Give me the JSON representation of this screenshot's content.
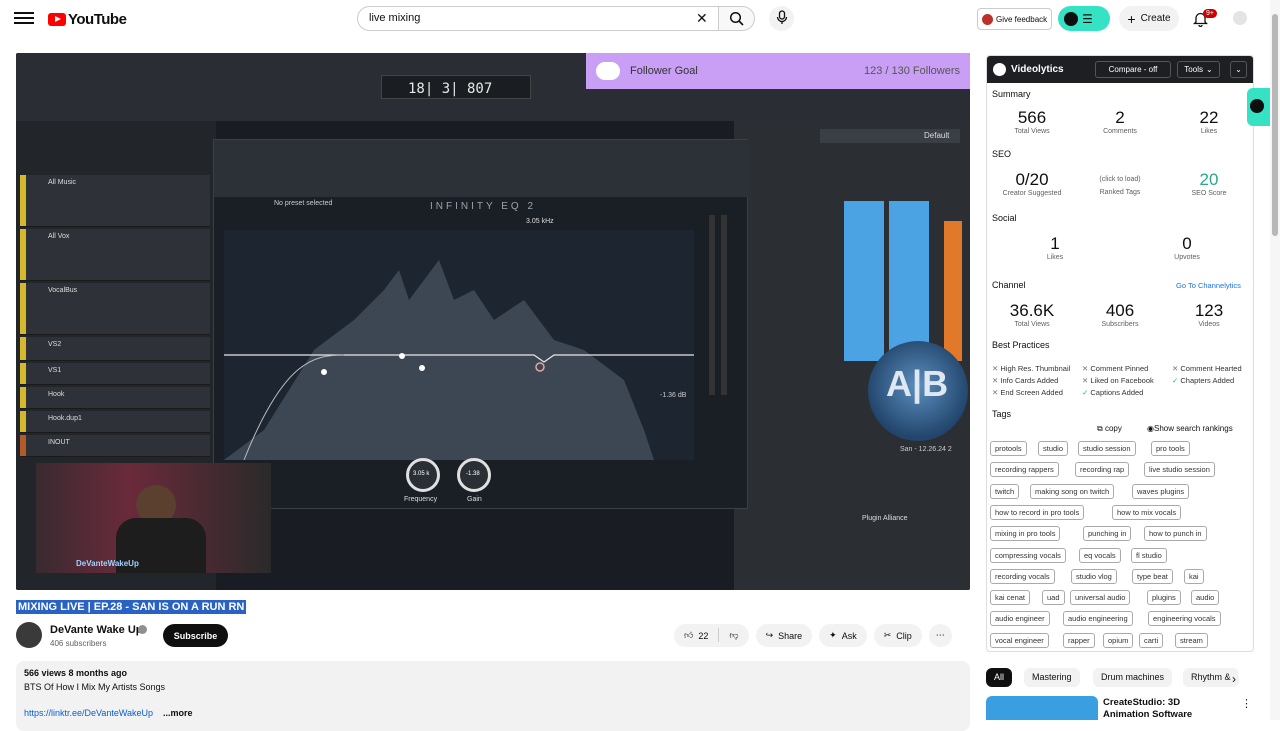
{
  "header": {
    "logo_text": "YouTube",
    "search_value": "live mixing",
    "feedback_label": "Give feedback",
    "create_label": "Create",
    "notif_count": "9+"
  },
  "video": {
    "follower_goal_label": "Follower Goal",
    "follower_goal_count": "123 / 130 Followers",
    "plugin_title": "INFINITY EQ 2",
    "preset_label": "No preset selected",
    "eq_freq_readout": "3.05 kHz",
    "eq_gain_readout": "-1.36 dB",
    "knob_frequency_label": "Frequency",
    "knob_frequency_value": "3.05 k",
    "knob_gain_label": "Gain",
    "knob_gain_value": "-1.38",
    "transport_readout": "18| 3| 807",
    "ab_text": "A|B",
    "ab_caption": "San - 12.26.24 2",
    "plugin_alliance": "Plugin Alliance",
    "default_label": "Default",
    "tracks": [
      "All Music",
      "All Vox",
      "VocalBus",
      "VS2",
      "VS1",
      "Hook",
      "Hook.dup1",
      "INOUT"
    ],
    "webcam_tag": "DeVanteWakeUp"
  },
  "below": {
    "title": "MIXING LIVE | EP.28 - SAN IS ON A RUN RN",
    "channel_name": "DeVante Wake Up",
    "subscribers": "406 subscribers",
    "subscribe_label": "Subscribe",
    "like_count": "22",
    "share_label": "Share",
    "ask_label": "Ask",
    "clip_label": "Clip",
    "views_meta": "566 views  8 months ago",
    "desc_line": "BTS Of How I Mix My Artists Songs",
    "desc_link": "https://linktr.ee/DeVanteWakeUp",
    "more_label": "...more"
  },
  "panel": {
    "title": "Videolytics",
    "compare_label": "Compare - off",
    "tools_label": "Tools",
    "summary_label": "Summary",
    "summary": [
      {
        "num": "566",
        "lbl": "Total Views"
      },
      {
        "num": "2",
        "lbl": "Comments"
      },
      {
        "num": "22",
        "lbl": "Likes"
      }
    ],
    "seo_label": "SEO",
    "seo_suggested_num": "0/20",
    "seo_suggested_lbl": "Creator Suggested",
    "seo_ranked_click": "(click to load)",
    "seo_ranked_lbl": "Ranked Tags",
    "seo_score_num": "20",
    "seo_score_lbl": "SEO Score",
    "social_label": "Social",
    "social_likes_num": "1",
    "social_likes_lbl": "Likes",
    "social_upvotes_num": "0",
    "social_upvotes_lbl": "Upvotes",
    "channel_label": "Channel",
    "channel_link": "Go To Channelytics",
    "channel": [
      {
        "num": "36.6K",
        "lbl": "Total Views"
      },
      {
        "num": "406",
        "lbl": "Subscribers"
      },
      {
        "num": "123",
        "lbl": "Videos"
      }
    ],
    "best_label": "Best Practices",
    "best": [
      {
        "ok": false,
        "text": "High Res. Thumbnail"
      },
      {
        "ok": false,
        "text": "Comment Pinned"
      },
      {
        "ok": false,
        "text": "Comment Hearted"
      },
      {
        "ok": false,
        "text": "Info Cards Added"
      },
      {
        "ok": false,
        "text": "Liked on Facebook"
      },
      {
        "ok": true,
        "text": "Chapters Added"
      },
      {
        "ok": false,
        "text": "End Screen Added"
      },
      {
        "ok": true,
        "text": "Captions Added"
      }
    ],
    "tags_label": "Tags",
    "copy_label": "copy",
    "show_rankings_label": "Show search rankings",
    "tags": [
      "protools",
      "studio",
      "studio session",
      "pro tools",
      "recording rappers",
      "recording rap",
      "live studio session",
      "twitch",
      "making song on twitch",
      "waves plugins",
      "how to record in pro tools",
      "how to mix vocals",
      "mixing in pro tools",
      "punching in",
      "how to punch in",
      "compressing vocals",
      "eq vocals",
      "fl studio",
      "recording vocals",
      "studio vlog",
      "type beat",
      "kai",
      "kai cenat",
      "uad",
      "universal audio",
      "plugins",
      "audio",
      "audio engineer",
      "audio engineering",
      "engineering vocals",
      "vocal engineer",
      "rapper",
      "opium",
      "carti",
      "stream"
    ]
  },
  "chips": [
    "All",
    "Mastering",
    "Drum machines",
    "Rhythm &"
  ],
  "suggestion": {
    "title": "CreateStudio: 3D Animation Software"
  },
  "colors": {
    "brand_red": "#ff0000",
    "extension_teal": "#35e3c4",
    "follower_purple": "#c99ff5",
    "selection_blue": "#2962c2"
  }
}
